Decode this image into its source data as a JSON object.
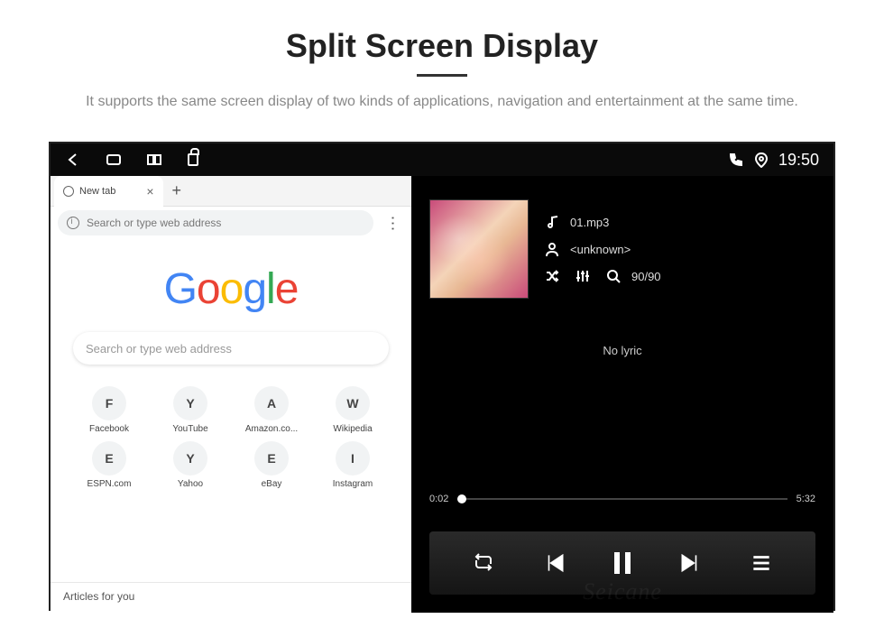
{
  "hero": {
    "title": "Split Screen Display",
    "subtitle": "It supports the same screen display of two kinds of applications, navigation and entertainment at the same time."
  },
  "statusbar": {
    "clock": "19:50"
  },
  "browser": {
    "tab_label": "New tab",
    "addr_placeholder": "Search or type web address",
    "search_placeholder": "Search or type web address",
    "articles_header": "Articles for you",
    "shortcuts": [
      {
        "letter": "F",
        "label": "Facebook"
      },
      {
        "letter": "Y",
        "label": "YouTube"
      },
      {
        "letter": "A",
        "label": "Amazon.co..."
      },
      {
        "letter": "W",
        "label": "Wikipedia"
      },
      {
        "letter": "E",
        "label": "ESPN.com"
      },
      {
        "letter": "Y",
        "label": "Yahoo"
      },
      {
        "letter": "E",
        "label": "eBay"
      },
      {
        "letter": "I",
        "label": "Instagram"
      }
    ]
  },
  "player": {
    "filename": "01.mp3",
    "artist": "<unknown>",
    "track_count": "90/90",
    "no_lyric": "No lyric",
    "elapsed": "0:02",
    "duration": "5:32"
  },
  "watermark": "Seicane"
}
